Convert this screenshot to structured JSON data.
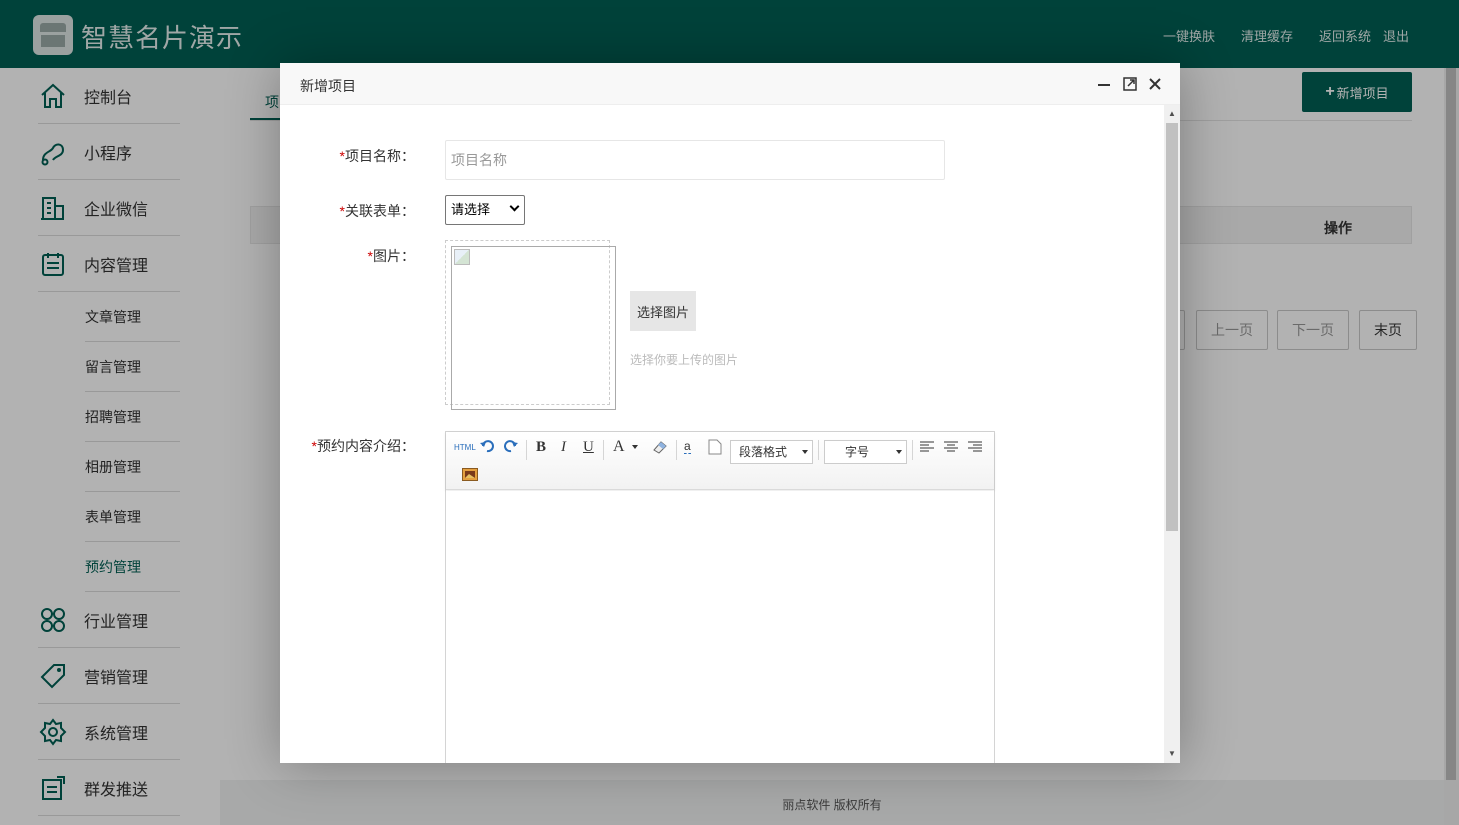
{
  "header": {
    "brand": "智慧名片演示",
    "links": [
      "一键换肤",
      "清理缓存",
      "返回系统",
      "退出"
    ]
  },
  "sidebar": {
    "items": [
      {
        "label": "控制台",
        "icon": "home-icon"
      },
      {
        "label": "小程序",
        "icon": "miniprogram-icon"
      },
      {
        "label": "企业微信",
        "icon": "building-icon"
      },
      {
        "label": "内容管理",
        "icon": "clipboard-icon"
      },
      {
        "label": "行业管理",
        "icon": "grid-icon"
      },
      {
        "label": "营销管理",
        "icon": "tag-icon"
      },
      {
        "label": "系统管理",
        "icon": "gear-icon"
      },
      {
        "label": "群发推送",
        "icon": "send-icon"
      }
    ],
    "subitems": [
      "文章管理",
      "留言管理",
      "招聘管理",
      "相册管理",
      "表单管理",
      "预约管理"
    ],
    "active_sub": "预约管理"
  },
  "main": {
    "tab": "项",
    "add_button": "新增项目",
    "table_op_header": "操作",
    "pager": [
      "上一页",
      "下一页",
      "末页"
    ],
    "footer": "丽点软件 版权所有"
  },
  "modal": {
    "title": "新增项目",
    "fields": {
      "name_label": "项目名称：",
      "name_placeholder": "项目名称",
      "form_label": "关联表单：",
      "form_value": "请选择",
      "image_label": "图片：",
      "pick_button": "选择图片",
      "pick_hint": "选择你要上传的图片",
      "intro_label": "预约内容介绍："
    },
    "editor": {
      "html_btn": "HTML",
      "paragraph": "段落格式",
      "fontsize": "字号"
    }
  },
  "colors": {
    "brand": "#005f53",
    "required": "#cc0000"
  }
}
